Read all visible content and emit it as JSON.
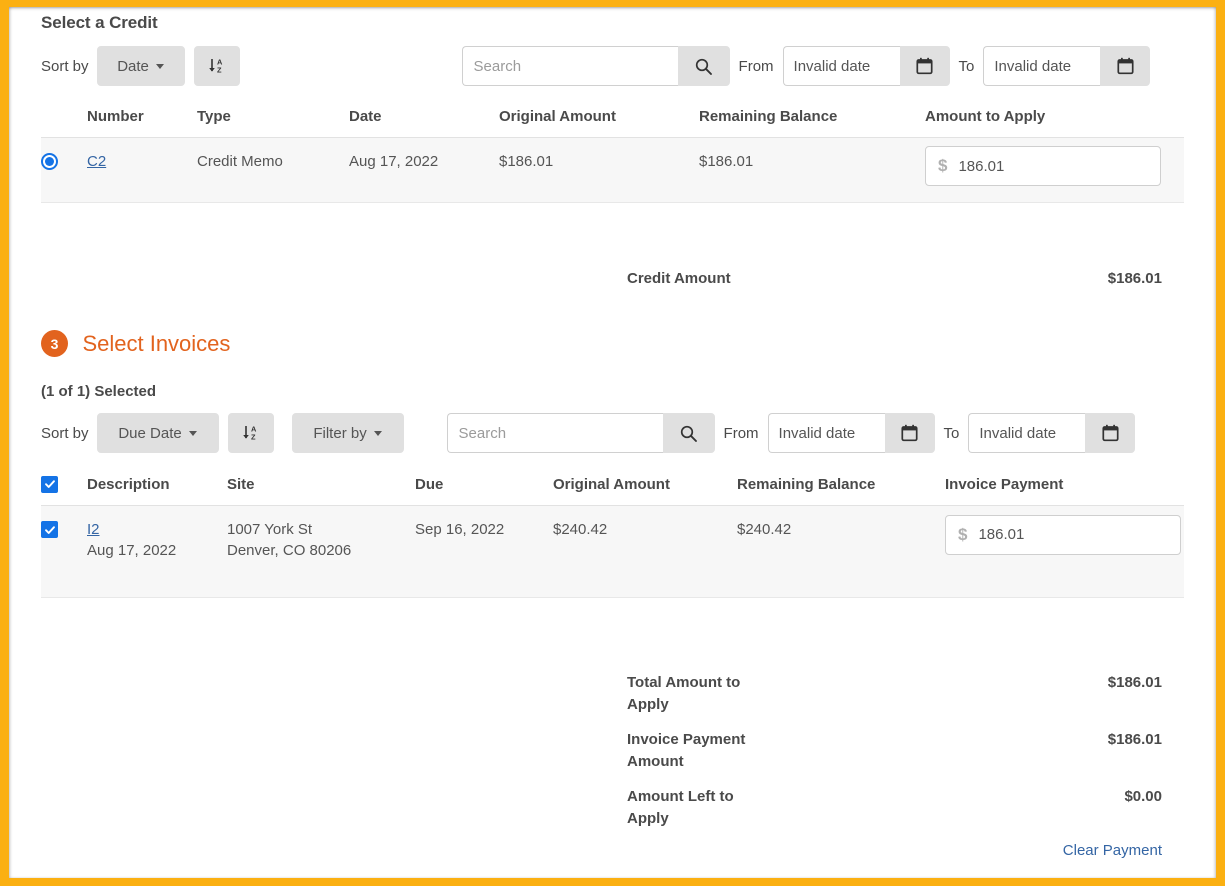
{
  "window": {
    "frame_color": "#FBB012",
    "accent_color": "#e2631e",
    "link_color": "#3465a4",
    "select_color": "#1473e6"
  },
  "credit_section": {
    "title": "Select a Credit",
    "toolbar": {
      "sort_by_label": "Sort by",
      "sort_field": "Date",
      "sort_direction_icon": "sort-descending-icon",
      "search_placeholder": "Search",
      "search_value": "",
      "search_icon": "search-icon",
      "from_label": "From",
      "from_value": "Invalid date",
      "to_label": "To",
      "to_value": "Invalid date",
      "calendar_icon": "calendar-icon"
    },
    "columns": [
      "",
      "Number",
      "Type",
      "Date",
      "Original Amount",
      "Remaining Balance",
      "Amount to Apply"
    ],
    "rows": [
      {
        "selected": true,
        "number": "C2",
        "type": "Credit Memo",
        "date": "Aug 17, 2022",
        "original_amount": "$186.01",
        "remaining_balance": "$186.01",
        "amount_to_apply": "186.01",
        "currency_symbol": "$"
      }
    ],
    "summary": {
      "label": "Credit Amount",
      "value": "$186.01"
    }
  },
  "invoices_section": {
    "step_number": "3",
    "title": "Select Invoices",
    "selected_count": "(1 of 1) Selected",
    "toolbar": {
      "sort_by_label": "Sort by",
      "sort_field": "Due Date",
      "sort_direction_icon": "sort-descending-icon",
      "filter_by_label": "Filter by",
      "search_placeholder": "Search",
      "search_value": "",
      "search_icon": "search-icon",
      "from_label": "From",
      "from_value": "Invalid date",
      "to_label": "To",
      "to_value": "Invalid date",
      "calendar_icon": "calendar-icon"
    },
    "columns": [
      "",
      "Description",
      "Site",
      "Due",
      "Original Amount",
      "Remaining Balance",
      "Invoice Payment"
    ],
    "header_select_all": true,
    "rows": [
      {
        "selected": true,
        "description": "I2",
        "description_date": "Aug 17, 2022",
        "site_line1": "1007 York St",
        "site_line2": "Denver, CO 80206",
        "due": "Sep 16, 2022",
        "original_amount": "$240.42",
        "remaining_balance": "$240.42",
        "invoice_payment": "186.01",
        "currency_symbol": "$"
      }
    ]
  },
  "totals": [
    {
      "label": "Total Amount to Apply",
      "value": "$186.01"
    },
    {
      "label": "Invoice Payment Amount",
      "value": "$186.01"
    },
    {
      "label": "Amount Left to Apply",
      "value": "$0.00"
    }
  ],
  "footer": {
    "clear_payment_label": "Clear Payment"
  }
}
